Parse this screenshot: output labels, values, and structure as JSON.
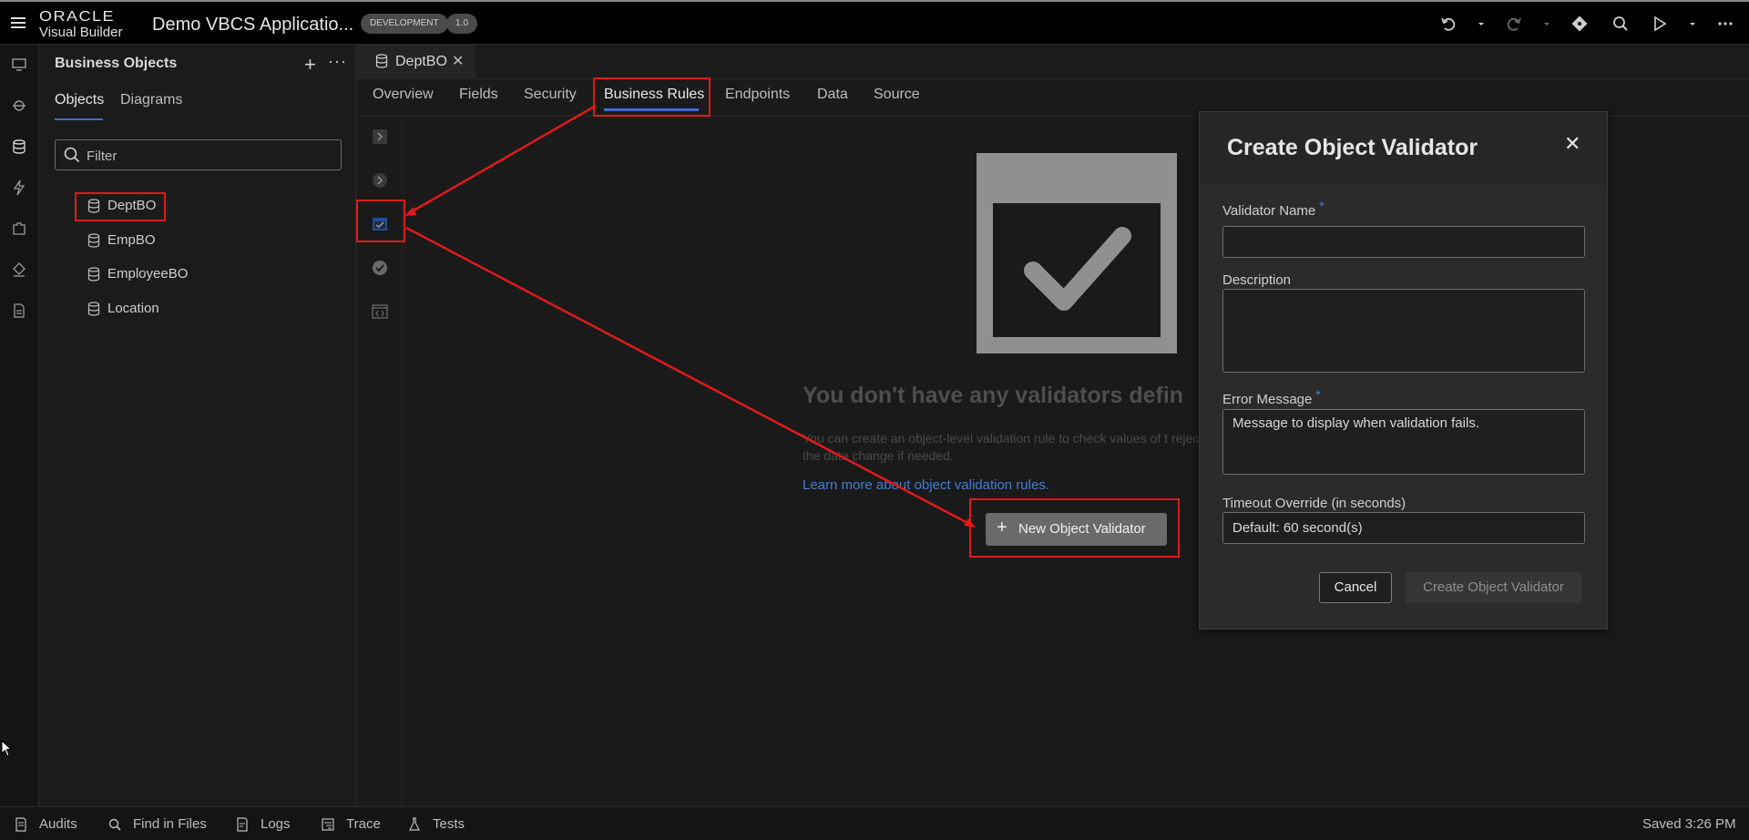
{
  "app": {
    "logo_top": "ORACLE",
    "logo_bottom": "Visual Builder",
    "title": "Demo VBCS Applicatio...",
    "env_badge": "DEVELOPMENT",
    "version_badge": "1.0"
  },
  "toolbar_icons": [
    "undo-icon",
    "redo-icon",
    "git-icon",
    "search-icon",
    "run-icon",
    "more-icon"
  ],
  "left_strip_icons": [
    "web-apps-icon",
    "services-icon",
    "business-objects-icon",
    "processes-icon",
    "components-icon",
    "layout-icon",
    "source-icon"
  ],
  "bo_panel": {
    "title": "Business Objects",
    "tabs": [
      "Objects",
      "Diagrams"
    ],
    "active_tab": "Objects",
    "filter_placeholder": "Filter",
    "items": [
      "DeptBO",
      "EmpBO",
      "EmployeeBO",
      "Location"
    ],
    "selected_item": "DeptBO"
  },
  "editor": {
    "doc_tab": "DeptBO",
    "nav": [
      "Overview",
      "Fields",
      "Security",
      "Business Rules",
      "Endpoints",
      "Data",
      "Source"
    ],
    "active_nav": "Business Rules",
    "side_icons": [
      "triggers-icon",
      "field-triggers-icon",
      "object-validators-icon",
      "field-validators-icon",
      "object-functions-icon"
    ]
  },
  "empty_state": {
    "title": "You don't have any validators defin",
    "description": "You can create an object-level validation rule to check values of t reject the data change if needed.",
    "link": "Learn more about object validation rules.",
    "button": "New Object Validator"
  },
  "dialog": {
    "title": "Create Object Validator",
    "fields": {
      "validator_name": {
        "label": "Validator Name",
        "value": "",
        "required": true
      },
      "description": {
        "label": "Description",
        "value": ""
      },
      "error_message": {
        "label": "Error Message",
        "placeholder": "Message to display when validation fails.",
        "required": true
      },
      "timeout": {
        "label": "Timeout Override (in seconds)",
        "placeholder": "Default: 60 second(s)"
      }
    },
    "cancel": "Cancel",
    "create": "Create Object Validator"
  },
  "footer": {
    "items": [
      "Audits",
      "Find in Files",
      "Logs",
      "Trace",
      "Tests"
    ],
    "status": "Saved 3:26 PM"
  },
  "colors": {
    "accent": "#3b6fd1",
    "annotation": "#e01a1a",
    "link": "#3f7fd6"
  }
}
